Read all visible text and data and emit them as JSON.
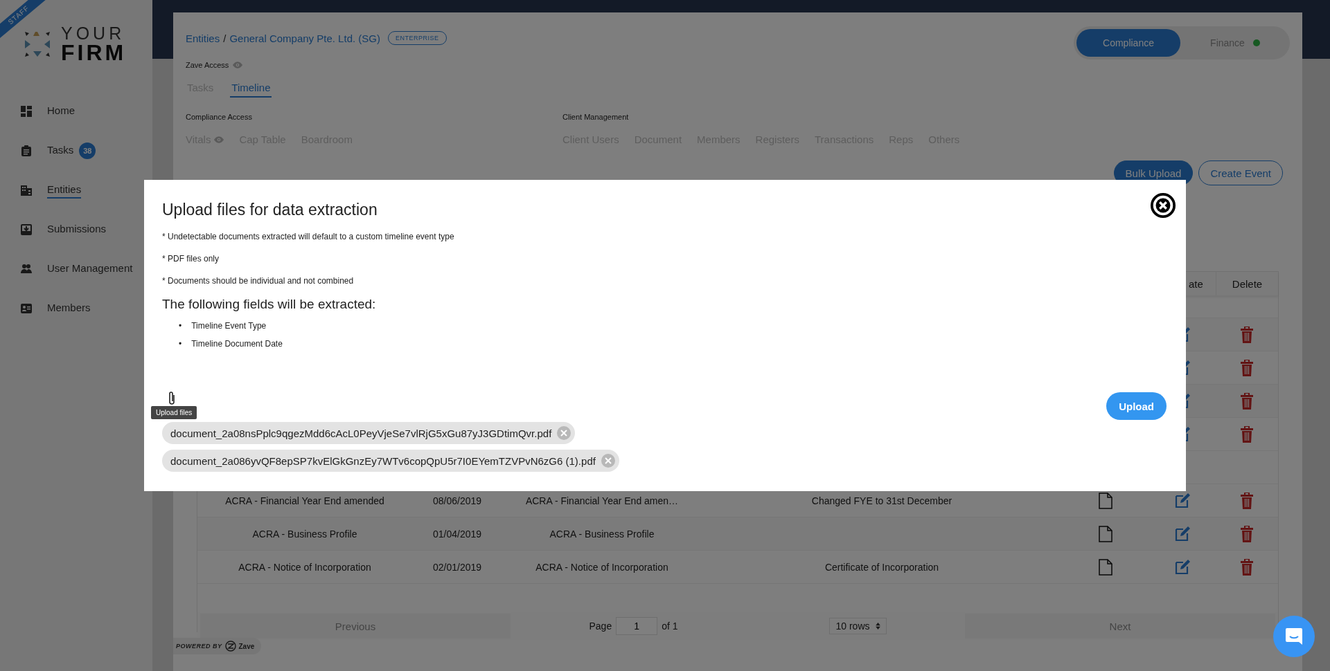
{
  "sidebar": {
    "ribbon": "STAFF",
    "logo": {
      "top": "YOUR",
      "bottom": "FIRM"
    },
    "items": [
      {
        "label": "Home",
        "selected": false
      },
      {
        "label": "Tasks",
        "selected": false,
        "badge": "38"
      },
      {
        "label": "Entities",
        "selected": true
      },
      {
        "label": "Submissions",
        "selected": false
      },
      {
        "label": "User Management",
        "selected": false
      },
      {
        "label": "Members",
        "selected": false
      }
    ]
  },
  "header": {
    "breadcrumb": [
      "Entities",
      "General Company Pte. Ltd. (SG)"
    ],
    "breadcrumb_separator": "/",
    "plan_badge": "ENTERPRISE",
    "mode_toggle": [
      {
        "label": "Compliance",
        "selected": true,
        "status_dot": false
      },
      {
        "label": "Finance",
        "selected": false,
        "status_dot": true
      }
    ],
    "access": {
      "label": "Zave Access",
      "eye": true
    },
    "tabs": [
      {
        "label": "Tasks",
        "selected": false
      },
      {
        "label": "Timeline",
        "selected": true
      }
    ],
    "sections": [
      {
        "title": "Compliance Access",
        "links": [
          {
            "label": "Vitals",
            "eye": true
          },
          {
            "label": "Cap Table",
            "eye": false
          },
          {
            "label": "Boardroom",
            "eye": false
          }
        ]
      },
      {
        "title": "Client Management",
        "links": [
          {
            "label": "Client Users",
            "eye": false
          },
          {
            "label": "Document",
            "eye": false
          },
          {
            "label": "Members",
            "eye": false
          },
          {
            "label": "Registers",
            "eye": false
          },
          {
            "label": "Transactions",
            "eye": false
          },
          {
            "label": "Reps",
            "eye": false
          },
          {
            "label": "Others",
            "eye": false
          }
        ]
      }
    ],
    "actions": [
      {
        "label": "Bulk Upload",
        "kind": "primary"
      },
      {
        "label": "Create Event",
        "kind": "outline"
      }
    ]
  },
  "table": {
    "columns": [
      {
        "label": "ate"
      },
      {
        "label": "Delete"
      }
    ],
    "rows": [
      {
        "kind": "blank"
      },
      {
        "kind": "covered"
      },
      {
        "kind": "covered"
      },
      {
        "kind": "covered"
      },
      {
        "kind": "covered"
      },
      {
        "kind": "blank"
      },
      {
        "kind": "entry",
        "cells": [
          "ACRA - Financial Year End amended",
          "08/06/2019",
          "ACRA - Financial Year End amen…",
          "Changed FYE to 31st December"
        ]
      },
      {
        "kind": "entry",
        "cells": [
          "ACRA - Business Profile",
          "01/04/2019",
          "ACRA - Business Profile"
        ]
      },
      {
        "kind": "entry",
        "cells": [
          "ACRA - Notice of Incorporation",
          "02/01/2019",
          "ACRA - Notice of Incorporation",
          "Certificate of Incorporation"
        ]
      }
    ]
  },
  "pagination": {
    "previous": {
      "label": "Previous",
      "disabled": true
    },
    "page_label": "Page",
    "page": "1",
    "of_label": "of 1",
    "rows": "10 rows",
    "next": {
      "label": "Next",
      "disabled": true
    }
  },
  "powered_by": {
    "text": "POWERED BY",
    "brand": "Zave"
  },
  "modal": {
    "title": "Upload files for data extraction",
    "notes": [
      "* Undetectable documents extracted will default to a custom timeline event type",
      "* PDF files only",
      "* Documents should be individual and not combined"
    ],
    "fields_heading": "The following fields will be extracted:",
    "fields": [
      {
        "bullet": "•",
        "label": "Timeline Event Type"
      },
      {
        "bullet": "•",
        "label": "Timeline Document Date"
      }
    ],
    "attach_tooltip": "Upload files",
    "files": [
      "document_2a08nsPplc9qgezMdd6cAcL0PeyVjeSe7vlRjG5xGu87yJ3GDtimQvr.pdf",
      "document_2a086yvQF8epSP7kvElGkGnzEy7WTv6copQpU5r7I0EYemTZVPvN6zG6 (1).pdf"
    ],
    "upload_button": "Upload"
  }
}
